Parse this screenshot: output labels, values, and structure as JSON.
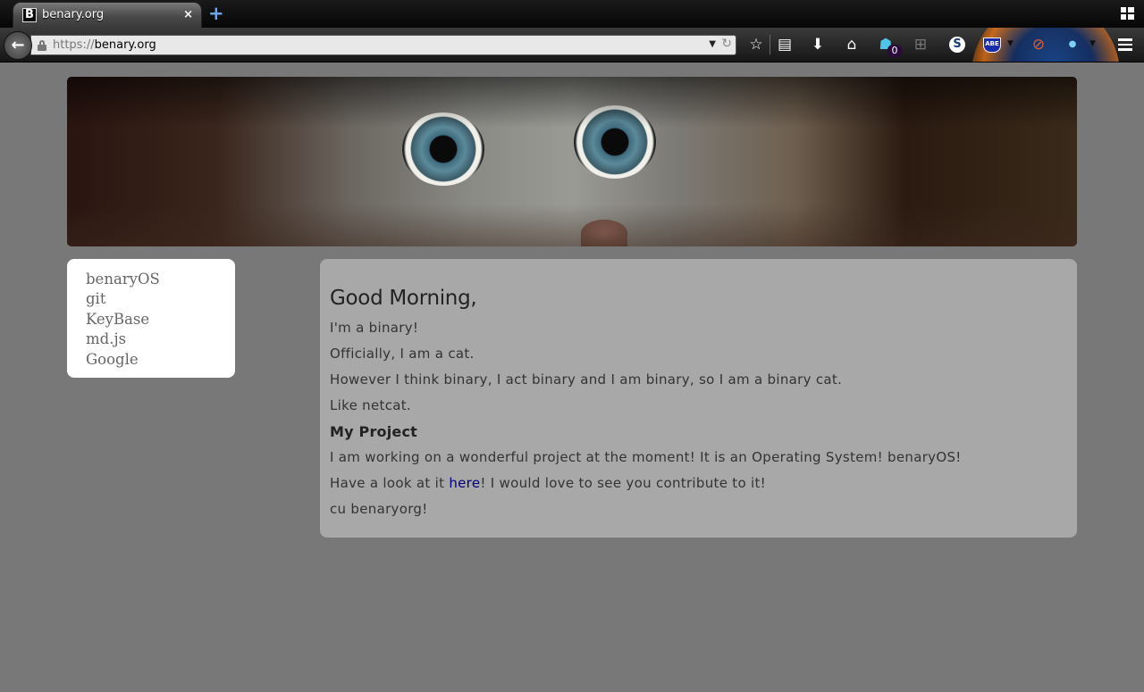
{
  "browser": {
    "tab": {
      "favicon": "B",
      "title": "benary.org",
      "close_label": "×"
    },
    "new_tab_label": "+",
    "back_label": "←",
    "url": {
      "scheme": "https://",
      "host": "benary.org"
    },
    "ghost_badge_count": "0",
    "s_icon_label": "S",
    "abe_label": "ABE"
  },
  "sidebar": {
    "links": [
      "benaryOS",
      "git",
      "KeyBase",
      "md.js",
      "Google"
    ]
  },
  "main": {
    "greeting": "Good Morning,",
    "intro": [
      "I'm a binary!",
      "Officially, I am a cat.",
      "However I think binary, I act binary and I am binary, so I am a binary cat.",
      "Like netcat."
    ],
    "project_heading": "My Project",
    "project_text": "I am working on a wonderful project at the moment! It is an Operating System! benaryOS!",
    "look_prefix": "Have a look at it ",
    "look_link": "here",
    "look_suffix": "! I would love to see you contribute to it!",
    "signoff": "cu benaryorg!"
  },
  "colors": {
    "page_bg": "#787878",
    "content_bg": "#a8a8a8",
    "sidebar_bg": "#ffffff",
    "link": "#000080"
  }
}
